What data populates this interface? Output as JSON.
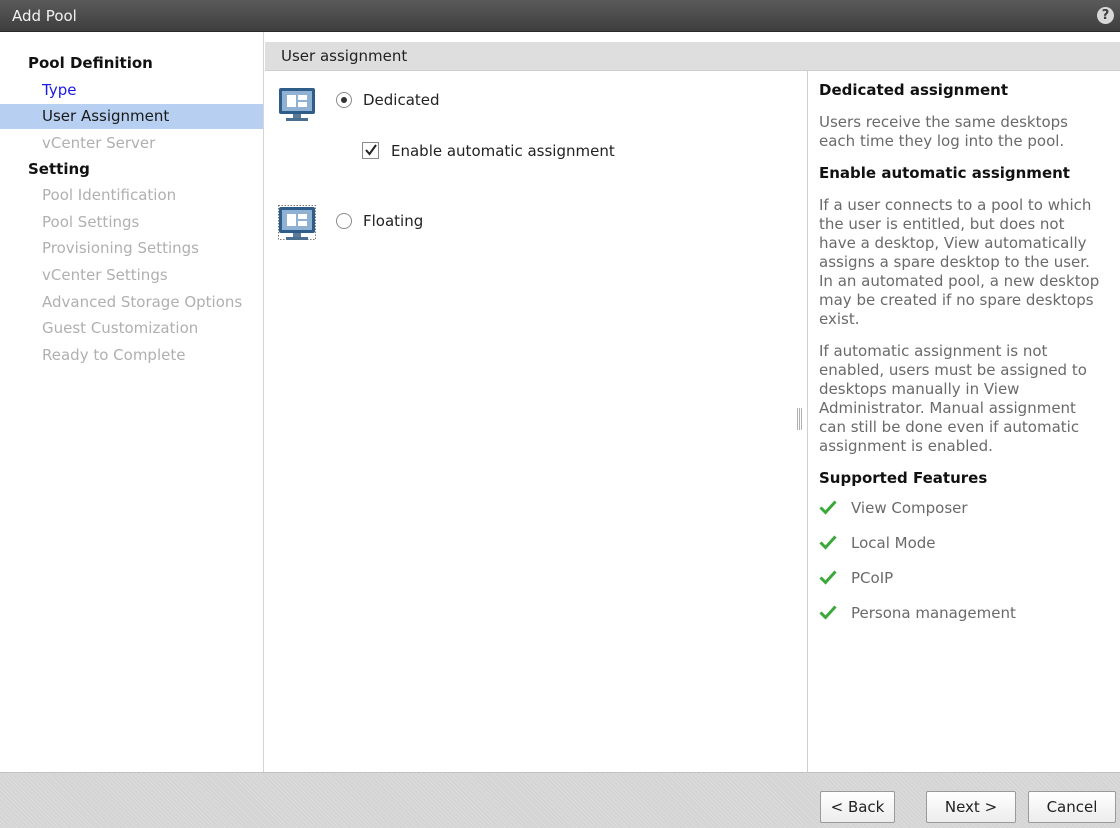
{
  "window": {
    "title": "Add Pool",
    "help_icon": "question-icon",
    "help_symbol": "?"
  },
  "sidebar": {
    "sections": [
      {
        "label": "Pool Definition"
      },
      {
        "label": "Setting"
      }
    ],
    "items": [
      {
        "label": "Type",
        "state": "done"
      },
      {
        "label": "User Assignment",
        "state": "active"
      },
      {
        "label": "vCenter Server",
        "state": "disabled"
      },
      {
        "label": "Pool Identification",
        "state": "disabled"
      },
      {
        "label": "Pool Settings",
        "state": "disabled"
      },
      {
        "label": "Provisioning Settings",
        "state": "disabled"
      },
      {
        "label": "vCenter Settings",
        "state": "disabled"
      },
      {
        "label": "Advanced Storage Options",
        "state": "disabled"
      },
      {
        "label": "Guest Customization",
        "state": "disabled"
      },
      {
        "label": "Ready to Complete",
        "state": "disabled"
      }
    ]
  },
  "main": {
    "header": "User assignment",
    "options": {
      "dedicated": {
        "label": "Dedicated",
        "selected": true,
        "icon": "desktop-icon"
      },
      "auto_assign": {
        "label": "Enable automatic assignment",
        "checked": true
      },
      "floating": {
        "label": "Floating",
        "selected": false,
        "icon": "desktop-icon"
      }
    }
  },
  "help": {
    "dedicated_title": "Dedicated assignment",
    "dedicated_text": [
      "Users receive the same desktops",
      "each time they log into the pool."
    ],
    "auto_title": "Enable automatic assignment",
    "auto_text1": [
      "If a user connects to a pool to which",
      "the user is entitled, but does not",
      "have a desktop, View automatically",
      "assigns a spare desktop to the user.",
      "In an automated pool, a new desktop",
      "may be created if no spare desktops",
      "exist."
    ],
    "auto_text2": [
      "If automatic assignment is not",
      "enabled, users must be assigned to",
      "desktops manually in View",
      "Administrator. Manual assignment",
      "can still be done even if automatic",
      "assignment is enabled."
    ],
    "features_title": "Supported Features",
    "features": [
      "View Composer",
      "Local Mode",
      "PCoIP",
      "Persona management"
    ],
    "feature_icon": "green-checkmark-icon"
  },
  "footer": {
    "back": "< Back",
    "next": "Next >",
    "cancel": "Cancel"
  },
  "colors": {
    "titlebar": "#4a4a4a",
    "active_item": "#b7cff0",
    "link": "#1a1ae6",
    "check_green": "#3aa83a"
  }
}
